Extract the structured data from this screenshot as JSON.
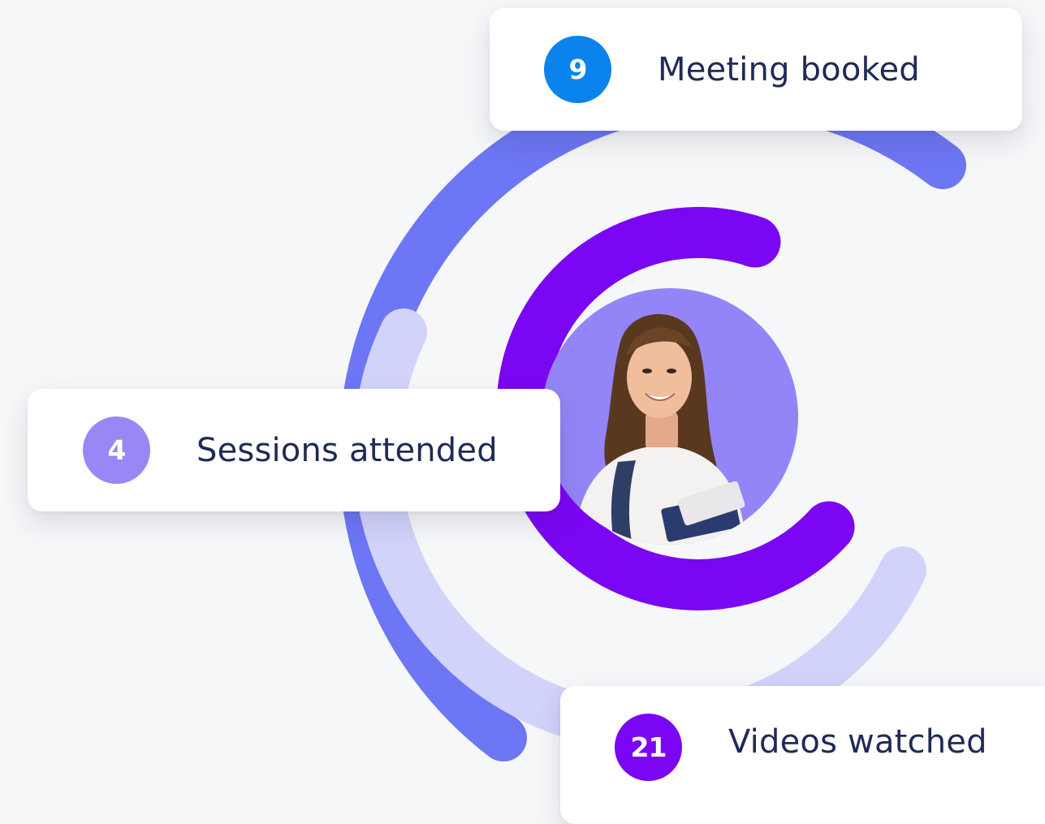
{
  "stats": [
    {
      "value": "9",
      "label": "Meeting booked",
      "badge_color": "#0a84ec"
    },
    {
      "value": "4",
      "label": "Sessions attended",
      "badge_color": "#9a87f5"
    },
    {
      "value": "21",
      "label": "Videos watched",
      "badge_color": "#7b06f3"
    }
  ],
  "arc_colors": {
    "outer": "#6d76f4",
    "middle": "#d1d3fb",
    "inner": "#7b06f3",
    "photo_background": "#9385f7"
  },
  "avatar": "student-photo"
}
